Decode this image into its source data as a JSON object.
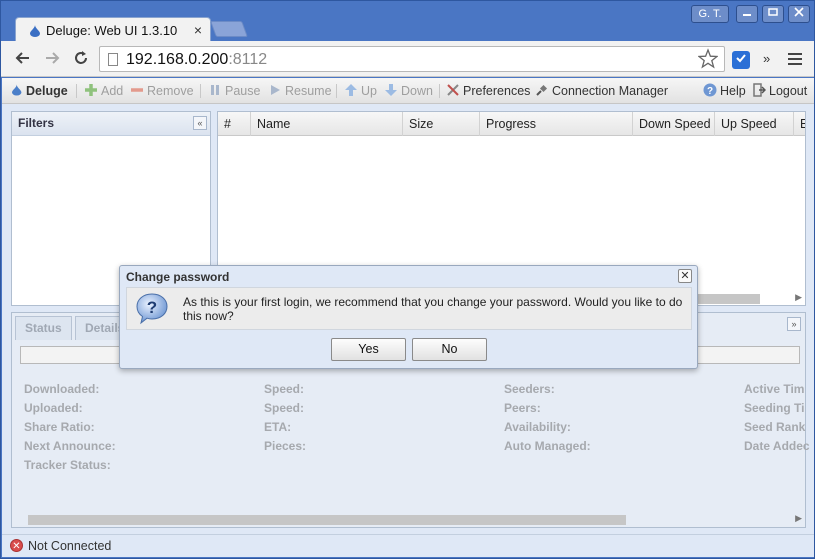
{
  "browser": {
    "tab_title": "Deluge: Web UI 1.3.10",
    "tab_close": "×",
    "user_badge": "G. T.",
    "url_host": "192.168.0.200",
    "url_port": ":8112",
    "overflow": "»"
  },
  "toolbar": {
    "deluge": "Deluge",
    "add": "Add",
    "remove": "Remove",
    "pause": "Pause",
    "resume": "Resume",
    "up": "Up",
    "down": "Down",
    "preferences": "Preferences",
    "connection_manager": "Connection Manager",
    "help": "Help",
    "logout": "Logout"
  },
  "filters": {
    "title": "Filters"
  },
  "grid": {
    "columns": [
      "#",
      "Name",
      "Size",
      "Progress",
      "Down Speed",
      "Up Speed",
      "E"
    ]
  },
  "details": {
    "tabs": [
      "Status",
      "Details"
    ],
    "fields": {
      "downloaded": "Downloaded:",
      "uploaded": "Uploaded:",
      "share_ratio": "Share Ratio:",
      "next_announce": "Next Announce:",
      "tracker_status": "Tracker Status:",
      "speed_down": "Speed:",
      "speed_up": "Speed:",
      "eta": "ETA:",
      "pieces": "Pieces:",
      "seeders": "Seeders:",
      "peers": "Peers:",
      "availability": "Availability:",
      "auto_managed": "Auto Managed:",
      "active_time": "Active Tim",
      "seeding_time": "Seeding Ti",
      "seed_rank": "Seed Rank",
      "date_added": "Date Addec"
    }
  },
  "status": {
    "text": "Not Connected"
  },
  "dialog": {
    "title": "Change password",
    "message": "As this is your first login, we recommend that you change your password. Would you like to do this now?",
    "yes": "Yes",
    "no": "No"
  },
  "colors": {
    "chrome_frame": "#4a76c4",
    "app_background": "#dfe8f6",
    "disabled_text": "#9e9e9e",
    "field_label": "#a6a9ae"
  }
}
